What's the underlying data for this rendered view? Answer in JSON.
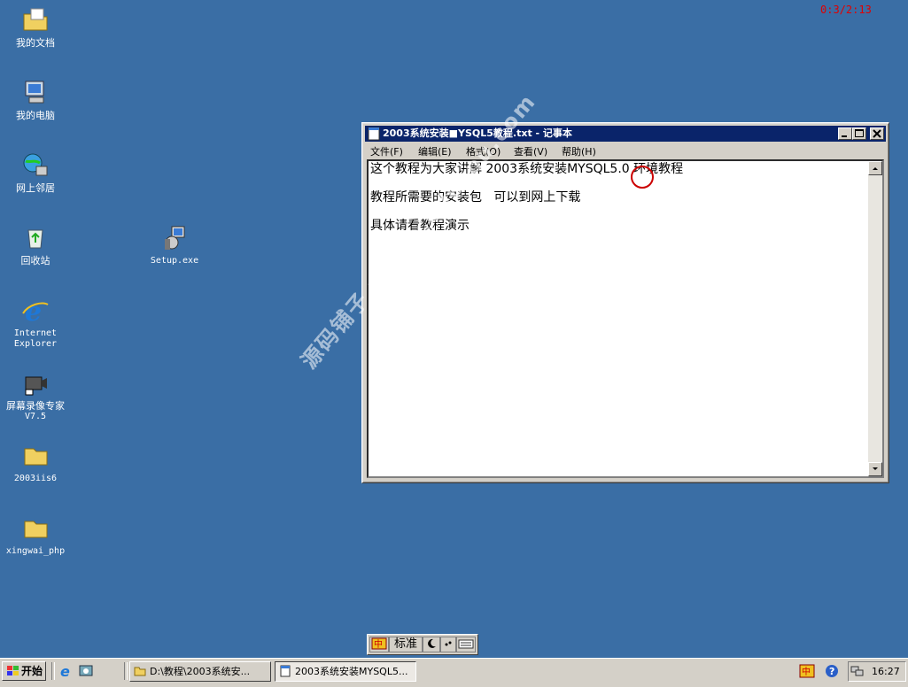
{
  "desktop": {
    "icons": [
      {
        "label": "我的文档"
      },
      {
        "label": "我的电脑"
      },
      {
        "label": "网上邻居"
      },
      {
        "label": "回收站"
      },
      {
        "label": "Setup.exe"
      },
      {
        "label": "Internet"
      },
      {
        "label": "Explorer"
      },
      {
        "label": "屏幕录像专家"
      },
      {
        "label": "V7.5"
      },
      {
        "label": "2003iis6"
      },
      {
        "label": "xingwai_php"
      }
    ],
    "timer": "0:3/2:13",
    "watermark": "源码铺子 www.codespu.com"
  },
  "notepad": {
    "title": "2003系统安装■YSQL5教程.txt - 记事本",
    "menu": [
      "文件(F)",
      "编辑(E)",
      "格式(O)",
      "查看(V)",
      "帮助(H)"
    ],
    "lines": [
      "这个教程为大家讲解 2003系统安装MYSQL5.0 环境教程",
      "教程所需要的安装包   可以到网上下载",
      "具体请看教程演示"
    ]
  },
  "ime": {
    "mode": "标准"
  },
  "taskbar": {
    "start": "开始",
    "tasks": [
      {
        "label": "D:\\教程\\2003系统安..."
      },
      {
        "label": "2003系统安装MYSQL5..."
      }
    ],
    "clock": "16:27"
  }
}
